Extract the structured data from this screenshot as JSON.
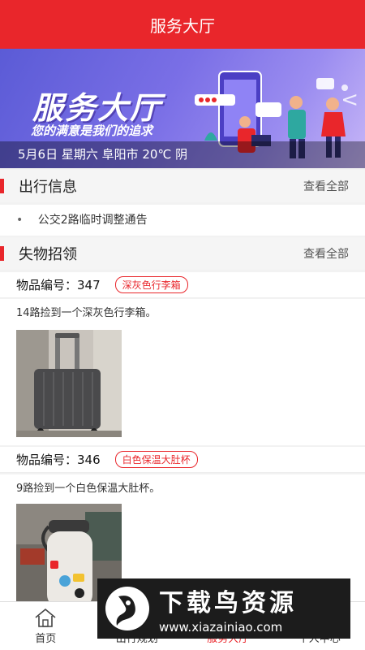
{
  "header": {
    "title": "服务大厅"
  },
  "banner": {
    "headline": "服务大厅",
    "slogan": "您的满意是我们的追求",
    "info": "5月6日 星期六 阜阳市 20℃ 阴",
    "arrow": "<"
  },
  "travel": {
    "title": "出行信息",
    "more": "查看全部",
    "items": [
      {
        "bullet": "•",
        "text": "公交2路临时调整通告"
      }
    ]
  },
  "lost": {
    "title": "失物招领",
    "more": "查看全部",
    "items": [
      {
        "number": "物品编号：347",
        "tag": "深灰色行李箱",
        "desc": "14路捡到一个深灰色行李箱。"
      },
      {
        "number": "物品编号：346",
        "tag": "白色保温大肚杯",
        "desc": "9路捡到一个白色保温大肚杯。"
      }
    ]
  },
  "tabs": [
    {
      "label": "首页",
      "icon": "home-icon",
      "active": false
    },
    {
      "label": "出行规划",
      "icon": "route-icon",
      "active": false
    },
    {
      "label": "服务大厅",
      "icon": "service-icon",
      "active": true
    },
    {
      "label": "个人中心",
      "icon": "user-icon",
      "active": false
    }
  ],
  "watermark": {
    "name": "下载鸟资源",
    "url": "www.xiazainiao.com"
  },
  "colors": {
    "brand_red": "#e9262b",
    "banner_purple": "#6b63dd"
  }
}
